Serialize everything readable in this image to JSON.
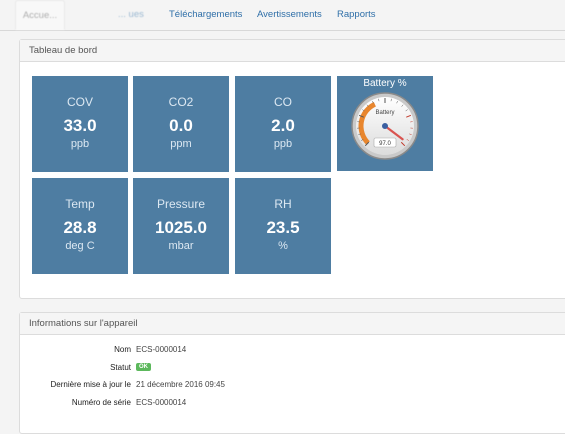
{
  "tabs": [
    {
      "label": "Accue..."
    },
    {
      "label": "... ues"
    },
    {
      "label": "Téléchargements"
    },
    {
      "label": "Avertissements"
    },
    {
      "label": "Rapports"
    }
  ],
  "dashboard": {
    "title": "Tableau de bord",
    "tiles": [
      {
        "label": "COV",
        "value": "33.0",
        "unit": "ppb"
      },
      {
        "label": "CO2",
        "value": "0.0",
        "unit": "ppm"
      },
      {
        "label": "CO",
        "value": "2.0",
        "unit": "ppb"
      },
      {
        "label": "Temp",
        "value": "28.8",
        "unit": "deg C"
      },
      {
        "label": "Pressure",
        "value": "1025.0",
        "unit": "mbar"
      },
      {
        "label": "RH",
        "value": "23.5",
        "unit": "%"
      }
    ],
    "gauge": {
      "title": "Battery %",
      "inner_label": "Battery",
      "value": "97.0",
      "level": 97.0,
      "tile_color": "#4e7da2"
    }
  },
  "device_info": {
    "title": "Informations sur l'appareil",
    "rows": [
      {
        "label": "Nom",
        "value": "ECS-0000014"
      },
      {
        "label": "Statut",
        "value": "OK"
      },
      {
        "label": "Dernière mise à jour le",
        "value": "21 décembre 2016 09:45"
      },
      {
        "label": "Numéro de série",
        "value": "ECS-0000014"
      }
    ],
    "status_color": "#5cb85c"
  }
}
